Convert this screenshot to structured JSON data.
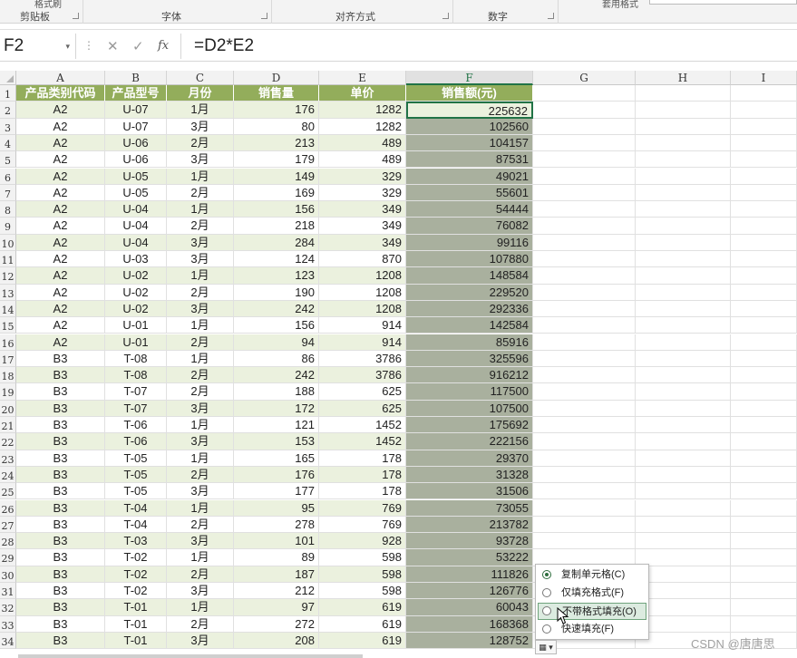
{
  "ribbon": {
    "groups": [
      {
        "label": "剪贴板",
        "top_fragment": "格式刷"
      },
      {
        "label": "字体",
        "top_fragment": ""
      },
      {
        "label": "对齐方式",
        "top_fragment": ""
      },
      {
        "label": "数字",
        "top_fragment": ""
      },
      {
        "label": "",
        "top_fragment": "套用格式"
      }
    ]
  },
  "formula_bar": {
    "name_box": "F2",
    "name_box_dropdown": "▾",
    "separator": "⋮",
    "cancel_icon": "✕",
    "enter_icon": "✓",
    "fx_icon": "fx",
    "formula": "=D2*E2"
  },
  "grid": {
    "columns": [
      "A",
      "B",
      "C",
      "D",
      "E",
      "F",
      "G",
      "H",
      "I"
    ],
    "selected_column": "F",
    "header_row": [
      "产品类别代码",
      "产品型号",
      "月份",
      "销售量",
      "单价",
      "销售额(元)"
    ],
    "rows": [
      [
        "A2",
        "U-07",
        "1月",
        "176",
        "1282",
        "225632"
      ],
      [
        "A2",
        "U-07",
        "3月",
        "80",
        "1282",
        "102560"
      ],
      [
        "A2",
        "U-06",
        "2月",
        "213",
        "489",
        "104157"
      ],
      [
        "A2",
        "U-06",
        "3月",
        "179",
        "489",
        "87531"
      ],
      [
        "A2",
        "U-05",
        "1月",
        "149",
        "329",
        "49021"
      ],
      [
        "A2",
        "U-05",
        "2月",
        "169",
        "329",
        "55601"
      ],
      [
        "A2",
        "U-04",
        "1月",
        "156",
        "349",
        "54444"
      ],
      [
        "A2",
        "U-04",
        "2月",
        "218",
        "349",
        "76082"
      ],
      [
        "A2",
        "U-04",
        "3月",
        "284",
        "349",
        "99116"
      ],
      [
        "A2",
        "U-03",
        "3月",
        "124",
        "870",
        "107880"
      ],
      [
        "A2",
        "U-02",
        "1月",
        "123",
        "1208",
        "148584"
      ],
      [
        "A2",
        "U-02",
        "2月",
        "190",
        "1208",
        "229520"
      ],
      [
        "A2",
        "U-02",
        "3月",
        "242",
        "1208",
        "292336"
      ],
      [
        "A2",
        "U-01",
        "1月",
        "156",
        "914",
        "142584"
      ],
      [
        "A2",
        "U-01",
        "2月",
        "94",
        "914",
        "85916"
      ],
      [
        "B3",
        "T-08",
        "1月",
        "86",
        "3786",
        "325596"
      ],
      [
        "B3",
        "T-08",
        "2月",
        "242",
        "3786",
        "916212"
      ],
      [
        "B3",
        "T-07",
        "2月",
        "188",
        "625",
        "117500"
      ],
      [
        "B3",
        "T-07",
        "3月",
        "172",
        "625",
        "107500"
      ],
      [
        "B3",
        "T-06",
        "1月",
        "121",
        "1452",
        "175692"
      ],
      [
        "B3",
        "T-06",
        "3月",
        "153",
        "1452",
        "222156"
      ],
      [
        "B3",
        "T-05",
        "1月",
        "165",
        "178",
        "29370"
      ],
      [
        "B3",
        "T-05",
        "2月",
        "176",
        "178",
        "31328"
      ],
      [
        "B3",
        "T-05",
        "3月",
        "177",
        "178",
        "31506"
      ],
      [
        "B3",
        "T-04",
        "1月",
        "95",
        "769",
        "73055"
      ],
      [
        "B3",
        "T-04",
        "2月",
        "278",
        "769",
        "213782"
      ],
      [
        "B3",
        "T-03",
        "3月",
        "101",
        "928",
        "93728"
      ],
      [
        "B3",
        "T-02",
        "1月",
        "89",
        "598",
        "53222"
      ],
      [
        "B3",
        "T-02",
        "2月",
        "187",
        "598",
        "111826"
      ],
      [
        "B3",
        "T-02",
        "3月",
        "212",
        "598",
        "126776"
      ],
      [
        "B3",
        "T-01",
        "1月",
        "97",
        "619",
        "60043"
      ],
      [
        "B3",
        "T-01",
        "2月",
        "272",
        "619",
        "168368"
      ],
      [
        "B3",
        "T-01",
        "3月",
        "208",
        "619",
        "128752"
      ]
    ],
    "colors": {
      "header_fill": "#93ad5b",
      "band_fill": "#ebf1de",
      "selection_fill": "#a9b09e",
      "active_border": "#217346"
    }
  },
  "autofill": {
    "button_icon": "autofill-options-icon",
    "options": [
      {
        "label": "复制单元格(C)",
        "selected": true
      },
      {
        "label": "仅填充格式(F)",
        "selected": false
      },
      {
        "label": "不带格式填充(O)",
        "selected": false
      },
      {
        "label": "快速填充(F)",
        "selected": false
      }
    ],
    "highlighted_index": 2
  },
  "watermark": "CSDN @唐唐思"
}
